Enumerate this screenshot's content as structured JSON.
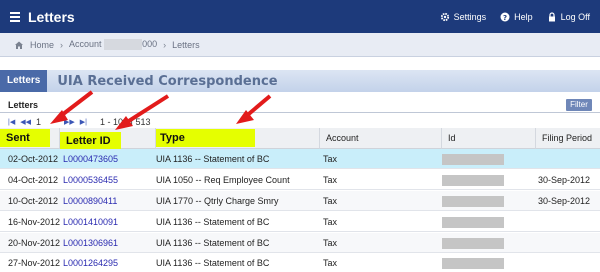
{
  "topbar": {
    "title": "Letters",
    "settings_label": "Settings",
    "help_label": "Help",
    "logoff_label": "Log Off"
  },
  "breadcrumb": {
    "home": "Home",
    "account_prefix": "Account",
    "account_suffix": "000",
    "current": "Letters"
  },
  "section": {
    "tab_label": "Letters",
    "heading": "UIA Received Correspondence"
  },
  "list": {
    "title": "Letters",
    "filter_label": "Filter",
    "pager": {
      "current_page": "1",
      "range_text": "1 - 10 of 513"
    },
    "columns": {
      "sent": "Sent",
      "letter_id": "Letter ID",
      "type": "Type",
      "account": "Account",
      "id": "Id",
      "filing_period": "Filing Period"
    },
    "rows": [
      {
        "sent": "02-Oct-2012",
        "letter_id": "L0000473605",
        "type": "UIA 1136 -- Statement of BC",
        "account": "Tax",
        "filing_period": ""
      },
      {
        "sent": "04-Oct-2012",
        "letter_id": "L0000536455",
        "type": "UIA 1050 -- Req Employee Count",
        "account": "Tax",
        "filing_period": "30-Sep-2012"
      },
      {
        "sent": "10-Oct-2012",
        "letter_id": "L0000890411",
        "type": "UIA 1770 -- Qtrly Charge Smry",
        "account": "Tax",
        "filing_period": "30-Sep-2012"
      },
      {
        "sent": "16-Nov-2012",
        "letter_id": "L0001410091",
        "type": "UIA 1136 -- Statement of BC",
        "account": "Tax",
        "filing_period": ""
      },
      {
        "sent": "20-Nov-2012",
        "letter_id": "L0001306961",
        "type": "UIA 1136 -- Statement of BC",
        "account": "Tax",
        "filing_period": ""
      },
      {
        "sent": "27-Nov-2012",
        "letter_id": "L0001264295",
        "type": "UIA 1136 -- Statement of BC",
        "account": "Tax",
        "filing_period": ""
      }
    ]
  },
  "colors": {
    "topbar": "#1d3a7b",
    "highlight": "#e5ff00",
    "arrow": "#e21b1b",
    "selected_row": "#c9eefa",
    "link": "#2a2ab0"
  }
}
